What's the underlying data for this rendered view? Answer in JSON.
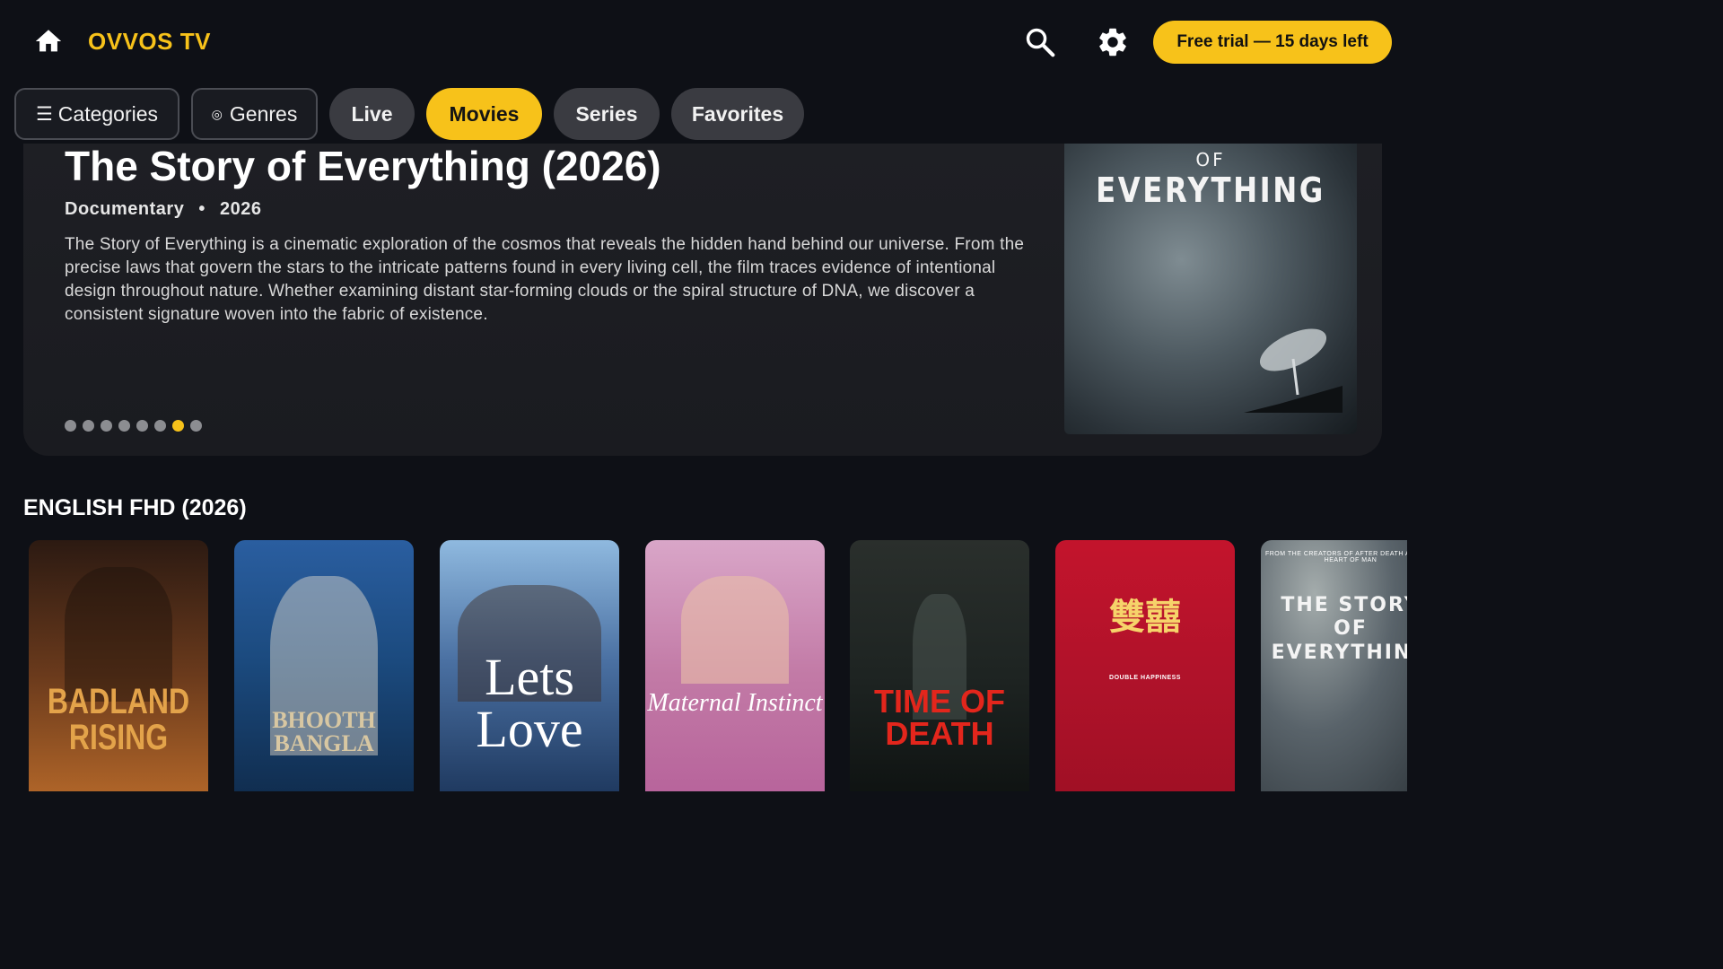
{
  "header": {
    "brand": "OVVOS TV",
    "trial_label": "Free trial — 15 days left"
  },
  "nav": {
    "categories": "Categories",
    "genres": "Genres",
    "tabs": [
      "Live",
      "Movies",
      "Series",
      "Favorites"
    ],
    "active_tab": "Movies"
  },
  "hero": {
    "title": "The Story of Everything (2026)",
    "genre": "Documentary",
    "separator": "•",
    "year": "2026",
    "description": "The Story of Everything is a cinematic exploration of the cosmos that reveals the hidden hand behind our universe. From the precise laws that govern the stars to the intricate patterns found in every living cell, the film traces evidence of intentional design throughout nature. Whether examining distant star-forming clouds or the spiral structure of DNA, we discover a consistent signature woven into the fabric of existence.",
    "slide_count": 8,
    "active_slide": 7,
    "poster": {
      "line1": "OF",
      "line2": "EVERYTHING"
    }
  },
  "row": {
    "title": "ENGLISH FHD (2026)",
    "posters": [
      {
        "title": "BADLAND RISING"
      },
      {
        "title": "BHOOTH BANGLA"
      },
      {
        "title": "Lets Love"
      },
      {
        "title": "Maternal Instinct"
      },
      {
        "title": "TIME OF DEATH"
      },
      {
        "title": "雙囍",
        "subtitle": "DOUBLE HAPPINESS"
      },
      {
        "title": "THE STORY OF EVERYTHING",
        "tagline": "FROM THE CREATORS OF AFTER DEATH AND THE HEART OF MAN"
      }
    ]
  },
  "colors": {
    "accent": "#f7c21a",
    "background": "#0e1016",
    "chip": "#3a3b41"
  },
  "icons": {
    "home": "home-icon",
    "search": "search-icon",
    "settings": "gear-icon",
    "menu": "menu-icon",
    "genres": "radio-dot-icon"
  }
}
